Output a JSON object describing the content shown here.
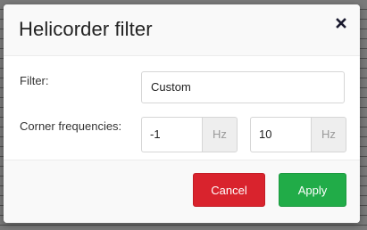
{
  "dialog": {
    "title": "Helicorder filter",
    "close_icon": "close-icon"
  },
  "form": {
    "filter_label": "Filter:",
    "filter_value": "Custom",
    "corner_label": "Corner frequencies:",
    "low_value": "-1",
    "low_unit": "Hz",
    "high_value": "10",
    "high_unit": "Hz"
  },
  "footer": {
    "cancel_label": "Cancel",
    "apply_label": "Apply"
  },
  "colors": {
    "cancel": "#d9232d",
    "apply": "#21ac48"
  }
}
